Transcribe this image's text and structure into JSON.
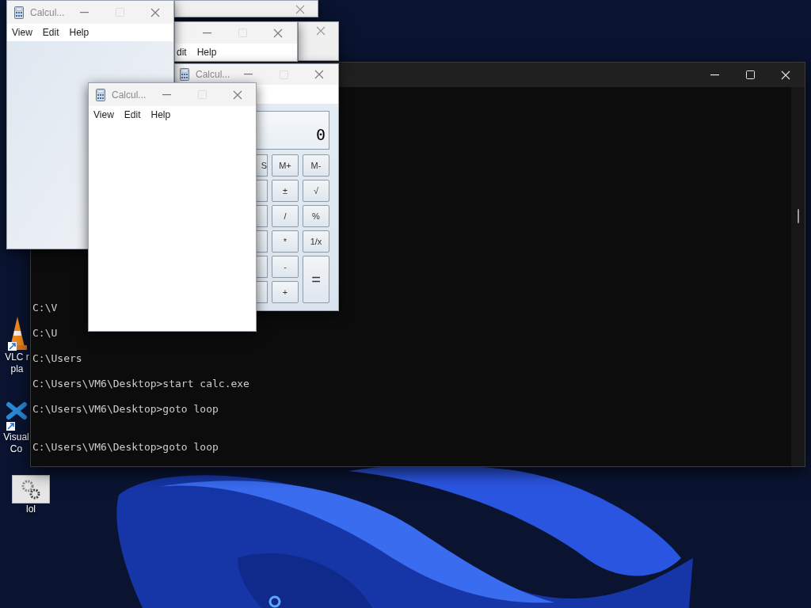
{
  "desktop_icons": [
    {
      "kind": "vlc",
      "label_lines": [
        "VLC r",
        "pla"
      ]
    },
    {
      "kind": "vscode",
      "label_lines": [
        "Visual",
        "Co"
      ]
    },
    {
      "kind": "settings",
      "label_lines": [
        "lol"
      ]
    }
  ],
  "terminal": {
    "lines": [
      "C:\\V",
      "C:\\U",
      "C:\\Users",
      "C:\\Users\\VM6\\Desktop>start calc.exe",
      "C:\\Users\\VM6\\Desktop>goto loop",
      "C:\\Users\\VM6\\Desktop>goto loop"
    ]
  },
  "calculator_windows": [
    {
      "kind": "strip"
    },
    {
      "kind": "strip"
    },
    {
      "kind": "partial",
      "menu": [
        "dit",
        "Help"
      ]
    },
    {
      "kind": "calculator",
      "title": "Calcul...",
      "display": "0",
      "rows": [
        {
          "edge": "S",
          "keys": [
            "M+",
            "M-"
          ]
        },
        {
          "keys": [
            "±",
            "√"
          ]
        },
        {
          "keys": [
            "/",
            "%"
          ]
        },
        {
          "keys": [
            "*",
            "1/x"
          ]
        },
        {
          "keys": [
            "-",
            "="
          ]
        },
        {
          "keys": [
            "+"
          ]
        }
      ]
    },
    {
      "kind": "blank",
      "title": "Calcul...",
      "menu": [
        "View",
        "Edit",
        "Help"
      ]
    },
    {
      "kind": "blank",
      "title": "Calcul...",
      "menu": [
        "View",
        "Edit",
        "Help"
      ]
    }
  ]
}
